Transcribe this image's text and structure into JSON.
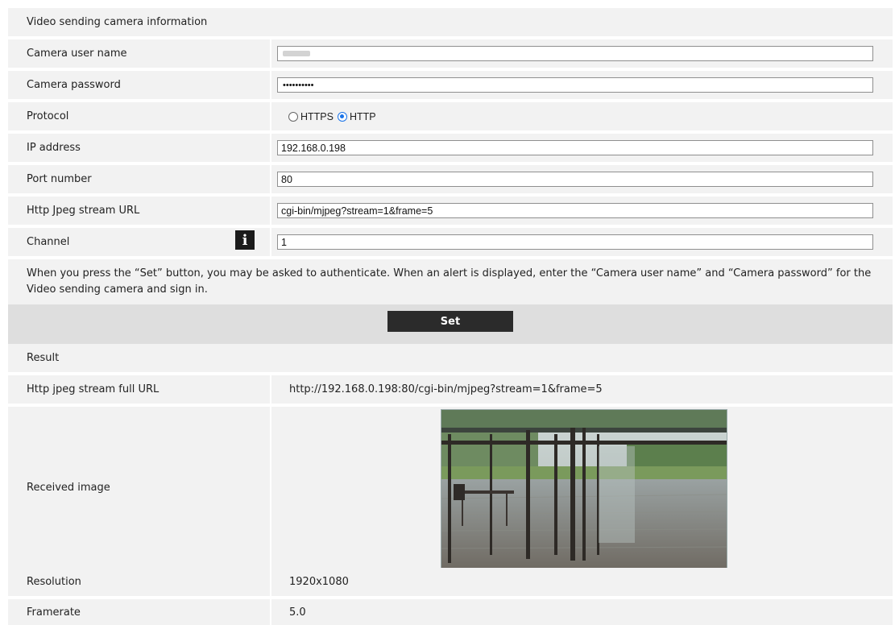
{
  "section_title": "Video sending camera information",
  "fields": {
    "user_name": {
      "label": "Camera user name",
      "value": ""
    },
    "password": {
      "label": "Camera password",
      "value": "••••••••••"
    },
    "protocol": {
      "label": "Protocol",
      "options": [
        {
          "label": "HTTPS",
          "checked": false
        },
        {
          "label": "HTTP",
          "checked": true
        }
      ]
    },
    "ip_address": {
      "label": "IP address",
      "value": "192.168.0.198"
    },
    "port": {
      "label": "Port number",
      "value": "80"
    },
    "jpeg_url": {
      "label": "Http Jpeg stream URL",
      "value": "cgi-bin/mjpeg?stream=1&frame=5"
    },
    "channel": {
      "label": "Channel",
      "value": "1",
      "info_icon": "info-icon"
    }
  },
  "note": "When you press the “Set” button, you may be asked to authenticate. When an alert is displayed, enter the “Camera user name” and “Camera password” for the Video sending camera and sign in.",
  "set_button": "Set",
  "result": {
    "title": "Result",
    "full_url": {
      "label": "Http jpeg stream full URL",
      "value": "http://192.168.0.198:80/cgi-bin/mjpeg?stream=1&frame=5"
    },
    "image": {
      "label": "Received image"
    },
    "resolution": {
      "label": "Resolution",
      "value": "1920x1080"
    },
    "framerate": {
      "label": "Framerate",
      "value": "5.0"
    }
  },
  "colors": {
    "band": "#f2f2f2",
    "button": "#2b2b2b",
    "radio_accent": "#1a73e8"
  }
}
